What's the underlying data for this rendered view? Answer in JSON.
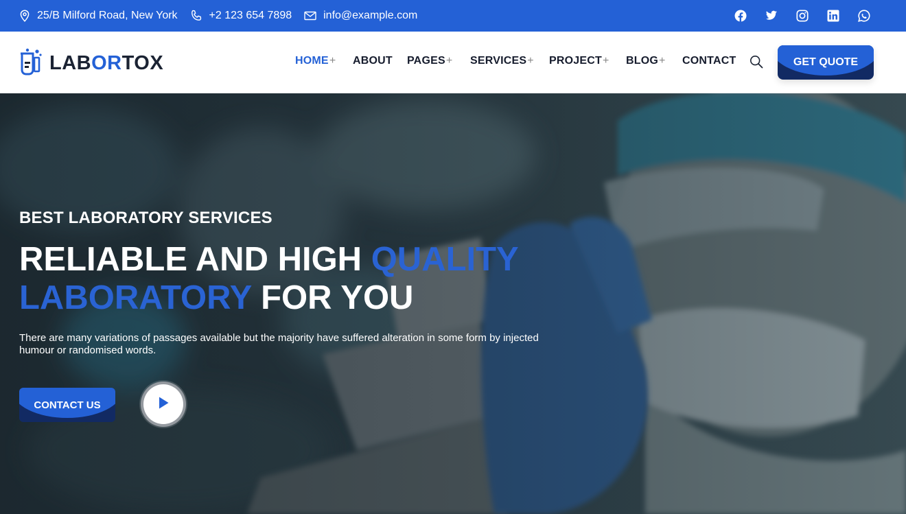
{
  "topbar": {
    "address": "25/B Milford Road, New York",
    "phone": "+2 123 654 7898",
    "email": "info@example.com",
    "social": [
      "facebook-icon",
      "twitter-icon",
      "instagram-icon",
      "linkedin-icon",
      "whatsapp-icon"
    ]
  },
  "logo": {
    "part1": "LAB",
    "part2": "OR",
    "part3": "TOX"
  },
  "nav": {
    "items": [
      {
        "label": "HOME",
        "plus": "+",
        "active": true
      },
      {
        "label": "ABOUT",
        "plus": "",
        "active": false
      },
      {
        "label": "PAGES",
        "plus": "+",
        "active": false
      },
      {
        "label": "SERVICES",
        "plus": "+",
        "active": false
      },
      {
        "label": "PROJECT",
        "plus": "+",
        "active": false
      },
      {
        "label": "BLOG",
        "plus": "+",
        "active": false
      },
      {
        "label": "CONTACT",
        "plus": "",
        "active": false
      }
    ],
    "quote_label": "GET QUOTE"
  },
  "hero": {
    "subtitle": "BEST LABORATORY SERVICES",
    "line1_plain": "RELIABLE AND HIGH ",
    "line1_highlight": "QUALITY",
    "line2_highlight": "LABORATORY",
    "line2_plain": " FOR YOU",
    "description": "There are many variations of passages available but the majority have suffered alteration in some form by injected humour or randomised words.",
    "contact_label": "CONTACT US"
  },
  "colors": {
    "primary": "#2461d6",
    "dark": "#122a63",
    "text_dark": "#161c2d"
  }
}
